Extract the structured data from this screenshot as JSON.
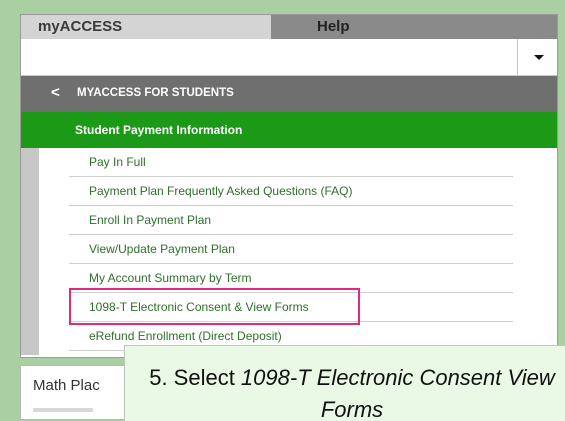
{
  "tabs": {
    "myaccess": "myACCESS",
    "help": "Help"
  },
  "section_header": {
    "title": "MYACCESS FOR STUDENTS"
  },
  "active_section": "Student Payment Information",
  "menu_items": [
    "Pay In Full",
    "Payment Plan Frequently Asked Questions (FAQ)",
    "Enroll In Payment Plan",
    "View/Update Payment Plan",
    "My Account Summary by Term",
    "1098-T Electronic Consent & View Forms",
    "eRefund Enrollment (Direct Deposit)"
  ],
  "highlighted_item_index": 5,
  "math_card": {
    "label": "Math Plac"
  },
  "callout": {
    "prefix": "5. Select ",
    "emphasis": "1098-T Electronic Consent View Forms"
  },
  "colors": {
    "green": "#1c9a17",
    "highlight": "#e0297a",
    "link": "#2f6f2c",
    "background": "#a9cfa3"
  }
}
